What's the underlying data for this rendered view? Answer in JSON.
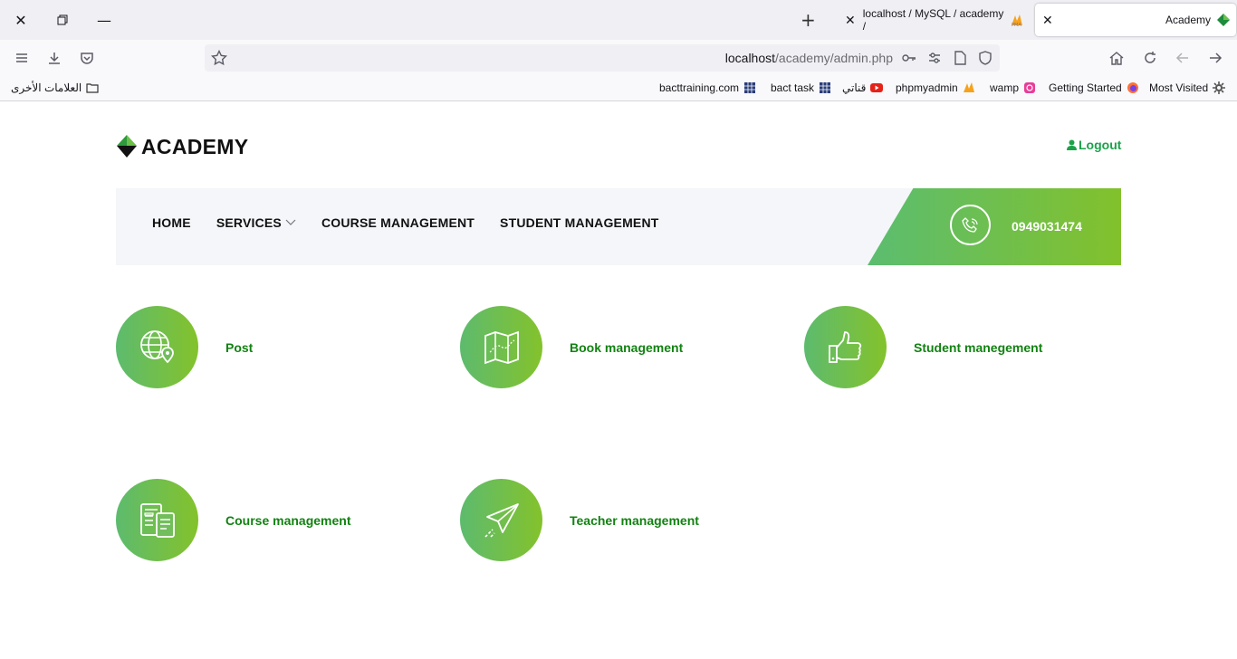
{
  "browser": {
    "tabs": [
      {
        "title": "Academy",
        "active": true
      },
      {
        "title": "localhost / MySQL / academy / ",
        "active": false
      }
    ],
    "url": {
      "host": "localhost",
      "path": "/academy/admin.php"
    },
    "bookmarks": {
      "other_bookmarks": "العلامات الأخرى",
      "items": [
        "bacttraining.com",
        "bact task",
        "قناتي",
        "phpmyadmin",
        "wamp",
        "Getting Started",
        "Most Visited"
      ]
    }
  },
  "site": {
    "logo_text": "ACADEMY",
    "logout_label": "Logout",
    "menu": [
      "HOME",
      "SERVICES",
      "COURSE MANAGEMENT",
      "STUDENT MANAGEMENT"
    ],
    "phone": "0949031474",
    "features": [
      {
        "label": "Post",
        "icon": "globe-pin-icon"
      },
      {
        "label": "Book management",
        "icon": "map-icon"
      },
      {
        "label": "Student manegement",
        "icon": "thumbs-up-icon"
      },
      {
        "label": "Course management",
        "icon": "documents-icon"
      },
      {
        "label": "Teacher management",
        "icon": "paper-plane-icon"
      }
    ]
  },
  "colors": {
    "brand_green": "#1ca24a",
    "link_green": "#128212",
    "gradient_start": "#5bbd70",
    "gradient_end": "#82c12c"
  }
}
